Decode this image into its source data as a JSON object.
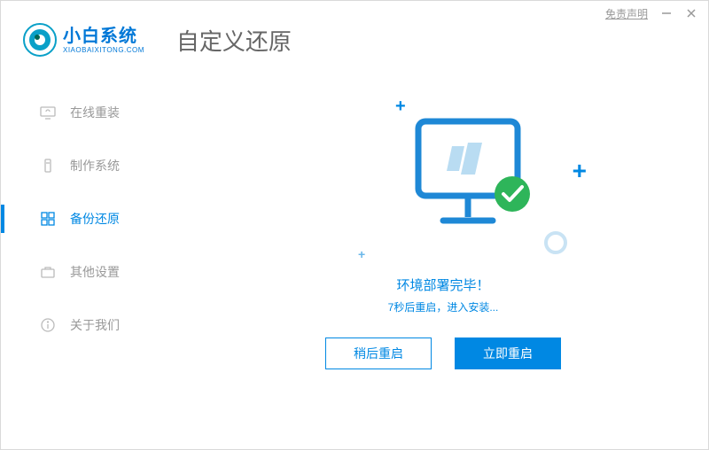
{
  "titlebar": {
    "disclaimer": "免责声明"
  },
  "brand": {
    "name": "小白系统",
    "url": "XIAOBAIXITONG.COM"
  },
  "page_title": "自定义还原",
  "sidebar": {
    "items": [
      {
        "label": "在线重装"
      },
      {
        "label": "制作系统"
      },
      {
        "label": "备份还原"
      },
      {
        "label": "其他设置"
      },
      {
        "label": "关于我们"
      }
    ]
  },
  "status": {
    "line1": "环境部署完毕！",
    "line2": "7秒后重启，进入安装..."
  },
  "buttons": {
    "later": "稍后重启",
    "now": "立即重启"
  }
}
